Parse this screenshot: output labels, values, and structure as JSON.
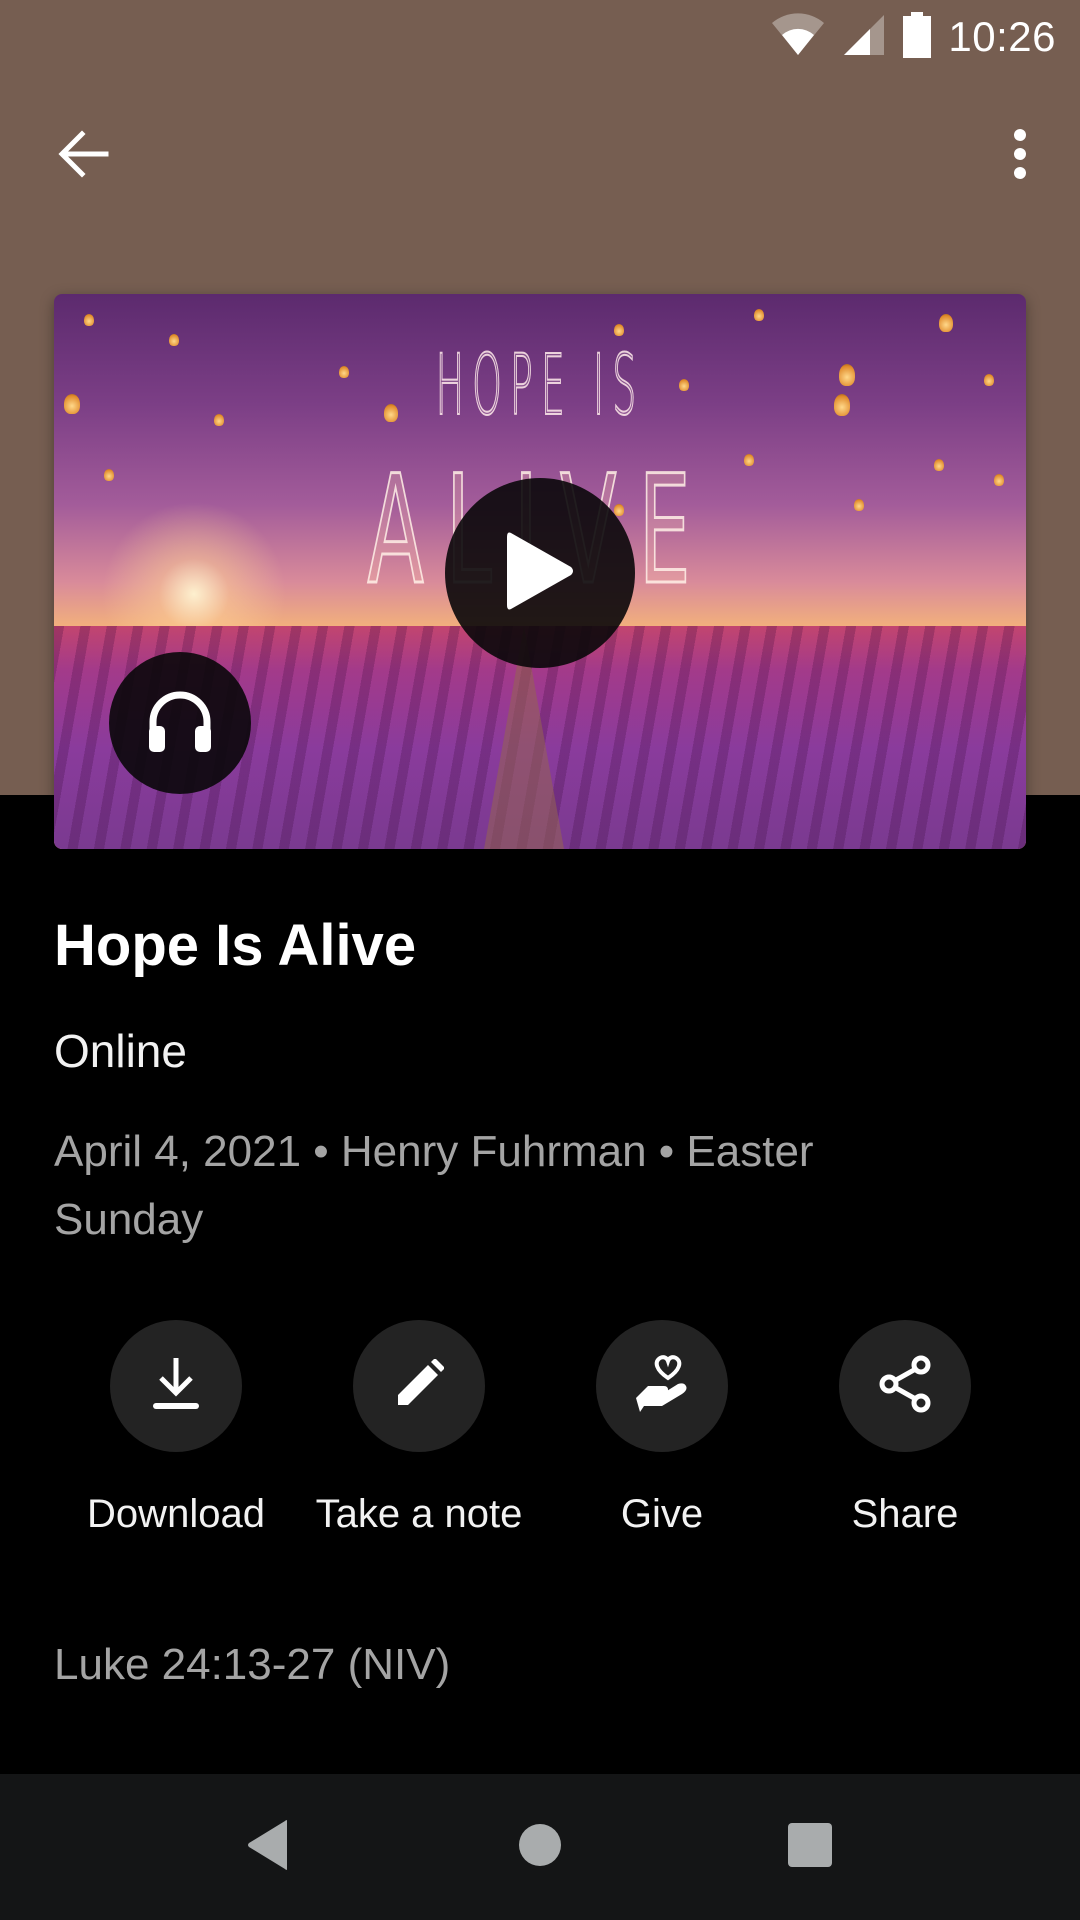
{
  "status_bar": {
    "time": "10:26",
    "icons": [
      "wifi-icon",
      "cellular-signal-icon",
      "battery-icon"
    ]
  },
  "app_bar": {
    "back_icon": "arrow-left-icon",
    "menu_icon": "more-vertical-icon"
  },
  "hero": {
    "artwork_text_top": "HOPE IS",
    "artwork_text_main": "ALIVE",
    "play_icon": "play-icon",
    "audio_icon": "headphones-icon"
  },
  "sermon": {
    "title": "Hope Is Alive",
    "location": "Online",
    "meta": "April 4, 2021 • Henry Fuhrman • Easter Sunday"
  },
  "actions": [
    {
      "label": "Download",
      "icon": "download-icon"
    },
    {
      "label": "Take a note",
      "icon": "pencil-icon"
    },
    {
      "label": "Give",
      "icon": "hand-heart-icon"
    },
    {
      "label": "Share",
      "icon": "share-icon"
    }
  ],
  "scripture": "Luke 24:13-27 (NIV)",
  "nav_bar": {
    "buttons": [
      "back-triangle-icon",
      "home-circle-icon",
      "recents-square-icon"
    ]
  },
  "colors": {
    "header_bg": "#765e51",
    "page_bg": "#000000",
    "action_circle": "#232323",
    "secondary_text": "#a4a4a4",
    "nav_bar_bg": "#141516"
  }
}
